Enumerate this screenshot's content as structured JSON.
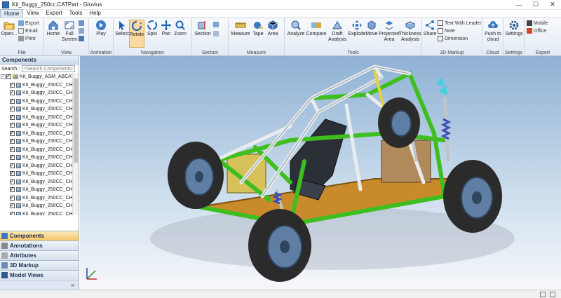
{
  "window": {
    "title": "Kit_Buggy_250cc.CATPart - Glovius",
    "minimize": "—",
    "maximize": "☐",
    "close": "✕"
  },
  "menu": [
    "Home",
    "View",
    "Export",
    "Tools",
    "Help"
  ],
  "ribbon": {
    "file": {
      "label": "File",
      "open": "Open...",
      "export": "Export",
      "email": "Email",
      "print": "Print"
    },
    "view": {
      "label": "View",
      "home": "Home",
      "full_screen": "Full Screen"
    },
    "animation": {
      "label": "Animation",
      "play": "Play"
    },
    "navigation": {
      "label": "Navigation",
      "select": "Select",
      "rotate": "Rotate",
      "spin": "Spin",
      "pan": "Pan",
      "zoom": "Zoom"
    },
    "section": {
      "label": "Section",
      "section": "Section"
    },
    "measure": {
      "label": "Measure",
      "measure": "Measure",
      "tape": "Tape",
      "area": "Area"
    },
    "tools": {
      "label": "Tools",
      "analyze": "Analyze",
      "compare": "Compare",
      "draft": "Draft Analysis",
      "explode": "Explode",
      "move": "Move",
      "projected": "Projected Area",
      "thickness": "Thickness Analysis"
    },
    "markup": {
      "label": "3D Markup",
      "share": "Share",
      "text_leader": "Text With Leader",
      "note": "Note",
      "dimension": "Dimension"
    },
    "cloud": {
      "label": "Cloud",
      "push": "Push to cloud"
    },
    "settings": {
      "label": "Settings",
      "settings": "Settings"
    },
    "export": {
      "label": "Export",
      "mobile": "Mobile",
      "office": "Office"
    }
  },
  "panel": {
    "title": "Components",
    "search_label": "Search :",
    "search_placeholder": "<Search Components>",
    "root": "Kit_Buggy_ASM_ABCAT",
    "items": [
      "Kit_Buggy_250CC_CH",
      "Kit_Buggy_250CC_CH",
      "Kit_Buggy_250CC_CH",
      "Kit_Buggy_250CC_CH",
      "Kit_Buggy_250CC_CH",
      "Kit_Buggy_250CC_CH",
      "Kit_Buggy_250CC_CH",
      "Kit_Buggy_250CC_CH",
      "Kit_Buggy_250CC_CH",
      "Kit_Buggy_250CC_CH",
      "Kit_Buggy_250CC_CH",
      "Kit_Buggy_250CC_CH",
      "Kit_Buggy_250CC_CH",
      "Kit_Buggy_250CC_CH",
      "Kit_Buggy_250CC_CH",
      "Kit_Buggy_250CC_CH",
      "Kit_Buggy_250CC_CH"
    ],
    "tabs": [
      "Components",
      "Annotations",
      "Attributes",
      "3D Markup",
      "Model Views"
    ],
    "footer": "»"
  },
  "colors": {
    "accent": "#2f6db5",
    "frame_green": "#3fbf1f",
    "frame_white": "#e8ecef",
    "tire": "#2b2b2b",
    "rim": "#5e7fa3",
    "spring": "#3a4fb8",
    "floor": "#c98a2c"
  }
}
